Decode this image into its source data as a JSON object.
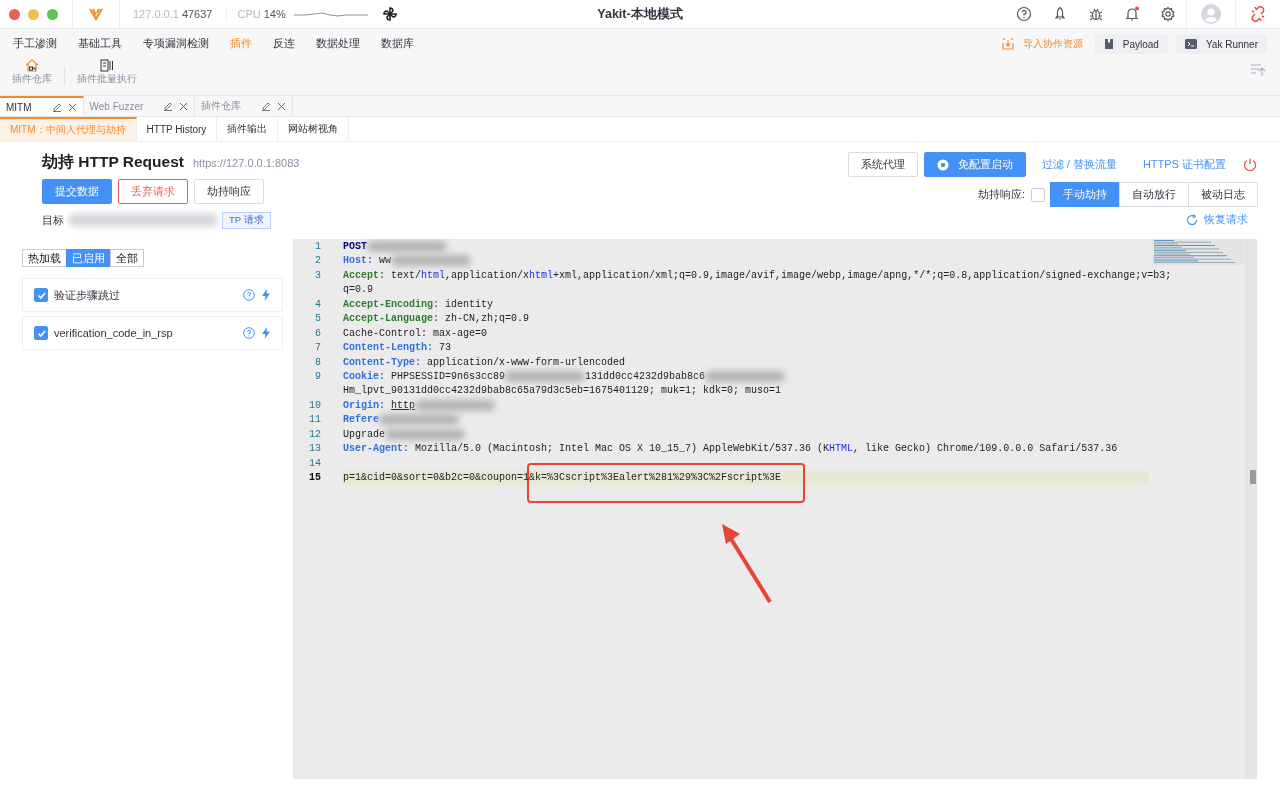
{
  "window": {
    "title": "Yakit-本地模式",
    "host": "127.0.0.1",
    "port": "47637",
    "cpu_label": "CPU",
    "cpu": "14%"
  },
  "menu": {
    "items": [
      {
        "label": "手工渗测",
        "selected": false
      },
      {
        "label": "基础工具",
        "selected": false
      },
      {
        "label": "专项漏洞检测",
        "selected": false
      },
      {
        "label": "插件",
        "selected": true
      },
      {
        "label": "反连",
        "selected": false
      },
      {
        "label": "数据处理",
        "selected": false
      },
      {
        "label": "数据库",
        "selected": false
      }
    ],
    "tools": [
      {
        "label": "插件仓库",
        "kind": "store"
      },
      {
        "label": "插件批量执行",
        "kind": "batch"
      }
    ],
    "actions": [
      {
        "label": "导入协作资源",
        "kind": "link"
      },
      {
        "label": "Payload",
        "kind": "payload"
      },
      {
        "label": "Yak Runner",
        "kind": "runner"
      }
    ]
  },
  "page_tabs": [
    {
      "label": "MITM",
      "selected": true
    },
    {
      "label": "Web Fuzzer",
      "selected": false
    },
    {
      "label": "插件仓库",
      "selected": false
    }
  ],
  "sub_tabs": [
    {
      "label": "MITM：中间人代理与劫持",
      "selected": true
    },
    {
      "label": "HTTP History",
      "selected": false
    },
    {
      "label": "插件输出",
      "selected": false
    },
    {
      "label": "网站树视角",
      "selected": false
    }
  ],
  "hijack": {
    "title": "劫持 HTTP Request",
    "url": "https://127.0.0.1:8083",
    "actions": [
      {
        "label": "提交数据",
        "kind": "primary"
      },
      {
        "label": "丢弃请求",
        "kind": "danger"
      },
      {
        "label": "劫持响应",
        "kind": "default"
      }
    ],
    "target_label": "目标",
    "target_tag": "TP 请求",
    "toolbar": [
      {
        "label": "系统代理",
        "kind": "default"
      },
      {
        "label": "免配置启动",
        "kind": "primary"
      },
      {
        "label": "过滤 / 替换流量",
        "kind": "link"
      },
      {
        "label": "HTTPS 证书配置",
        "kind": "link"
      }
    ],
    "hijack_response": {
      "label": "劫持响应:",
      "checked": false
    },
    "modes": [
      {
        "label": "手动劫持",
        "selected": true
      },
      {
        "label": "自动放行",
        "selected": false
      },
      {
        "label": "被动日志",
        "selected": false
      }
    ],
    "restore": "恢复请求"
  },
  "plugins": {
    "filters": [
      {
        "label": "热加载",
        "selected": false
      },
      {
        "label": "已启用",
        "selected": true
      },
      {
        "label": "全部",
        "selected": false
      }
    ],
    "items": [
      {
        "name": "验证步骤跳过",
        "checked": true
      },
      {
        "name": "verification_code_in_rsp",
        "checked": true
      }
    ]
  },
  "editor": {
    "lines": [
      {
        "number": "1",
        "current": false,
        "segments": [
          {
            "kind": "method",
            "text": "POST"
          },
          {
            "kind": "blur"
          }
        ]
      },
      {
        "number": "2",
        "current": false,
        "segments": [
          {
            "kind": "key",
            "text": "Host:"
          },
          {
            "kind": "text",
            "text": " ww"
          },
          {
            "kind": "blur"
          }
        ]
      },
      {
        "number": "3",
        "current": false,
        "segments": [
          {
            "kind": "accept-key",
            "text": "Accept:"
          },
          {
            "kind": "text",
            "text": " text/"
          },
          {
            "kind": "kw",
            "text": "html"
          },
          {
            "kind": "text",
            "text": ",application/x"
          },
          {
            "kind": "kw",
            "text": "html"
          },
          {
            "kind": "text",
            "text": "+xml,application/xml;q=0.9,image/avif,image/webp,image/apng,*/*;q=0.8,application/signed-exchange;v=b3;"
          }
        ],
        "continuation": [
          {
            "kind": "text",
            "text": "q=0.9"
          }
        ]
      },
      {
        "number": "4",
        "current": false,
        "segments": [
          {
            "kind": "accept-key",
            "text": "Accept-Encoding:"
          },
          {
            "kind": "text",
            "text": " identity"
          }
        ]
      },
      {
        "number": "5",
        "current": false,
        "segments": [
          {
            "kind": "accept-key",
            "text": "Accept-Language:"
          },
          {
            "kind": "text",
            "text": " zh-CN,zh;q=0.9"
          }
        ]
      },
      {
        "number": "6",
        "current": false,
        "segments": [
          {
            "kind": "text",
            "text": "Cache-Control: max-age=0"
          }
        ]
      },
      {
        "number": "7",
        "current": false,
        "segments": [
          {
            "kind": "key",
            "text": "Content-Length:"
          },
          {
            "kind": "text",
            "text": " 73"
          }
        ]
      },
      {
        "number": "8",
        "current": false,
        "segments": [
          {
            "kind": "key",
            "text": "Content-Type:"
          },
          {
            "kind": "text",
            "text": " application/x-www-form-urlencoded"
          }
        ]
      },
      {
        "number": "9",
        "current": false,
        "segments": [
          {
            "kind": "key",
            "text": "Cookie:"
          },
          {
            "kind": "text",
            "text": " PHPSESSID=9n6s3cc89"
          },
          {
            "kind": "blur"
          },
          {
            "kind": "text",
            "text": "131dd0cc4232d9bab8c6"
          },
          {
            "kind": "blur"
          }
        ],
        "continuation": [
          {
            "kind": "text",
            "text": "Hm_lpvt_90131dd0cc4232d9bab8c65a79d3c5eb=1675401129; muk=1; kdk=0; muso=1"
          }
        ]
      },
      {
        "number": "10",
        "current": false,
        "segments": [
          {
            "kind": "key",
            "text": "Origin:"
          },
          {
            "kind": "link",
            "text": "http"
          },
          {
            "kind": "blur"
          }
        ]
      },
      {
        "number": "11",
        "current": false,
        "segments": [
          {
            "kind": "key",
            "text": "Refere"
          },
          {
            "kind": "blur"
          }
        ]
      },
      {
        "number": "12",
        "current": false,
        "segments": [
          {
            "kind": "text",
            "text": "Upgrade"
          },
          {
            "kind": "blur"
          }
        ]
      },
      {
        "number": "13",
        "current": false,
        "segments": [
          {
            "kind": "key",
            "text": "User-Agent:"
          },
          {
            "kind": "text",
            "text": " Mozilla/5.0 (Macintosh; Intel Mac OS X 10_15_7) AppleWebKit/537.36 (K"
          },
          {
            "kind": "kw",
            "text": "HTML"
          },
          {
            "kind": "text",
            "text": ", like Gecko) Chrome/109.0.0.0 Safari/537.36"
          }
        ]
      },
      {
        "number": "14",
        "current": false
      },
      {
        "number": "15",
        "current": true,
        "segments": [
          {
            "kind": "text",
            "text": "p=1&cid=0&sort=0&b2c=0&coupon=1&k=%3Cscript%3Ealert%281%29%3C%2Fscript%3E"
          }
        ]
      }
    ]
  }
}
